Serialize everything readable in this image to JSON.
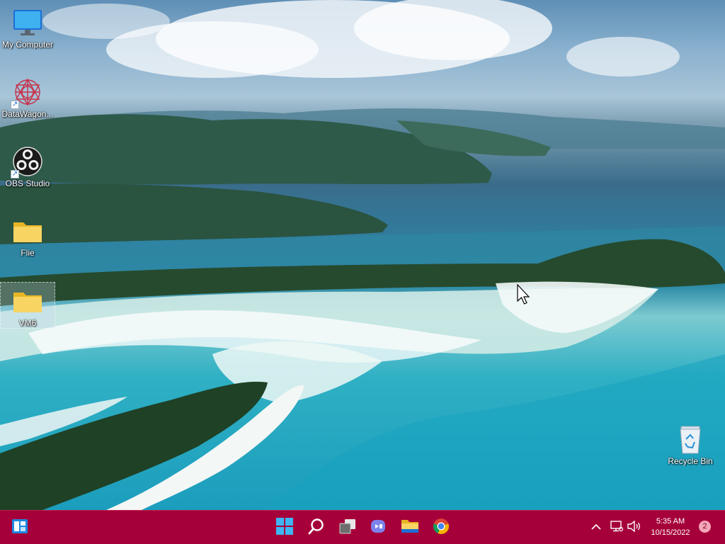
{
  "desktop": {
    "icons": [
      {
        "label": "My Computer",
        "icon": "monitor-icon"
      },
      {
        "label": "DataWagon...",
        "icon": "datawagon-icon",
        "shortcut": true
      },
      {
        "label": "OBS Studio",
        "icon": "obs-icon",
        "shortcut": true
      },
      {
        "label": "Flie",
        "icon": "folder-icon"
      },
      {
        "label": "VM6",
        "icon": "folder-icon",
        "selected": true
      },
      {
        "label": "Recycle Bin",
        "icon": "recycle-bin-icon"
      }
    ]
  },
  "taskbar": {
    "color": "#a6003a",
    "pinned": [
      {
        "name": "start",
        "icon": "windows-logo-icon"
      },
      {
        "name": "search",
        "icon": "search-icon"
      },
      {
        "name": "task-view",
        "icon": "task-view-icon"
      },
      {
        "name": "chat",
        "icon": "teams-chat-icon"
      },
      {
        "name": "file-explorer",
        "icon": "folder-icon"
      },
      {
        "name": "chrome",
        "icon": "chrome-icon"
      }
    ],
    "tray": {
      "time": "5:35 AM",
      "date": "10/15/2022",
      "notification_count": "2"
    }
  }
}
